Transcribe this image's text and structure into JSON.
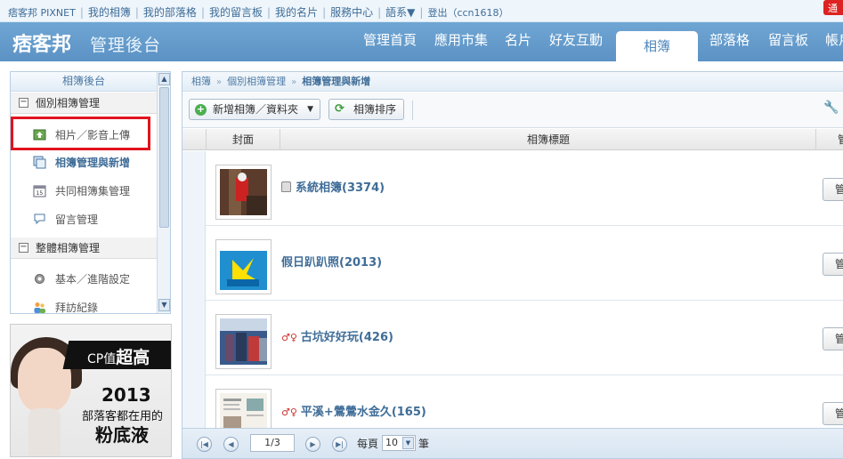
{
  "topbar": {
    "links": [
      "痞客邦 PIXNET",
      "我的相簿",
      "我的部落格",
      "我的留言板",
      "我的名片",
      "服務中心",
      "語系▼",
      "登出（ccn1618）"
    ],
    "notice": "通"
  },
  "header": {
    "logo": "痞客邦",
    "subtitle": "管理後台",
    "nav": [
      "管理首頁",
      "應用市集",
      "名片",
      "好友互動",
      "相簿",
      "部落格",
      "留言板",
      "帳戶"
    ],
    "active_nav": "相簿"
  },
  "sidebar": {
    "title": "相簿後台",
    "section1": "個別相簿管理",
    "items1": [
      "相片／影音上傳",
      "相簿管理與新增",
      "共同相簿集管理",
      "留言管理"
    ],
    "section2": "整體相簿管理",
    "items2": [
      "基本／進階設定",
      "拜訪紀錄"
    ]
  },
  "ad": {
    "line1_prefix": "CP值",
    "line1_big": "超高",
    "line2": "2013",
    "line3": "部落客都在用的",
    "line4": "粉底液"
  },
  "main": {
    "breadcrumb": [
      "相簿",
      "個別相簿管理",
      "相簿管理與新增"
    ],
    "toolbar": {
      "add_label": "新增相簿／資料夾",
      "sort_label": "相簿排序"
    },
    "columns": [
      "封面",
      "相簿標題",
      "管理"
    ],
    "albums": [
      {
        "title": "系統相簿(3374)",
        "manage": "管理"
      },
      {
        "title": "假日趴趴照(2013)",
        "manage": "管理"
      },
      {
        "title": "古坑好好玩(426)",
        "manage": "管理"
      },
      {
        "title": "平溪+鶯鶯水金久(165)",
        "manage": "管理"
      }
    ],
    "pager": {
      "page": "1/3",
      "per_page_label": "每頁",
      "per_page": "10",
      "unit": "筆"
    }
  },
  "colors": {
    "header_blue": "#5c92c4",
    "link_blue": "#3f6d98",
    "highlight_red": "#e0141e"
  }
}
